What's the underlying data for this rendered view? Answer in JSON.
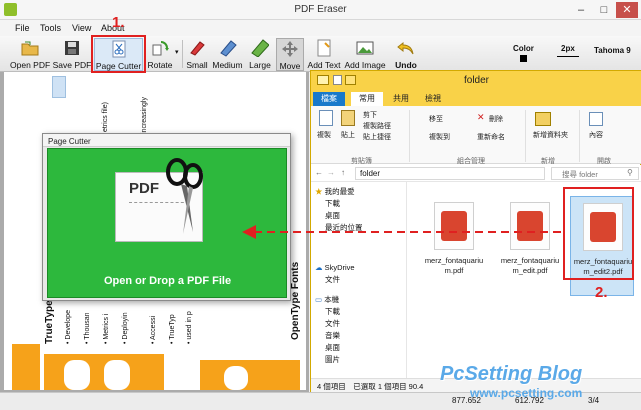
{
  "app": {
    "title": "PDF Eraser",
    "window_controls": [
      "–",
      "□",
      "✕"
    ],
    "menu": [
      "File",
      "Tools",
      "View",
      "About"
    ],
    "toolbar": [
      {
        "label": "Open PDF",
        "icon": "open-folder-icon"
      },
      {
        "label": "Save PDF",
        "icon": "floppy-disk-icon"
      },
      {
        "label": "Page Cutter",
        "icon": "page-cutter-icon"
      },
      {
        "label": "Rotate",
        "icon": "rotate-icon"
      },
      {
        "label": "Small",
        "icon": "eraser-small-icon"
      },
      {
        "label": "Medium",
        "icon": "eraser-medium-icon"
      },
      {
        "label": "Large",
        "icon": "eraser-large-icon"
      },
      {
        "label": "Move",
        "icon": "move-icon"
      },
      {
        "label": "Add Text",
        "icon": "add-text-icon"
      },
      {
        "label": "Add Image",
        "icon": "add-image-icon"
      },
      {
        "label": "Undo",
        "icon": "undo-icon"
      }
    ],
    "color_label": "Color",
    "size_value": "2px",
    "font_value": "Tahoma 9",
    "status": {
      "left": "877.652",
      "middle": "612.792",
      "page": "3/4"
    }
  },
  "document_text": {
    "col1": [
      "TrueType Fonts",
      "• Develope",
      "• Thousan",
      "• Metrics i",
      "• Deployin"
    ],
    "col2": [
      "• Accessi",
      "• TrueTyp",
      "• used in p"
    ],
    "right_vertical": [
      "OpenType Fonts"
    ],
    "top_vertical": [
      "etrics file)",
      "increasingly"
    ]
  },
  "page_cutter": {
    "title": "Page Cutter",
    "drop_label": "Open or Drop a PDF File",
    "pdf_label": "PDF"
  },
  "explorer": {
    "title": "folder",
    "tabs": [
      "檔案",
      "常用",
      "共用",
      "檢視"
    ],
    "ribbon": {
      "clipboard": [
        "複製",
        "貼上",
        "剪下",
        "複製路徑",
        "貼上捷徑"
      ],
      "clipboard_group": "剪貼簿",
      "organize": [
        "移至",
        "複製到",
        "刪除",
        "重新命名"
      ],
      "organize_group": "組合管理",
      "new": [
        "新增資料夾"
      ],
      "new_group": "新增",
      "open": [
        "內容"
      ],
      "open_group": "開啟"
    },
    "address": "folder",
    "search_placeholder": "搜尋 folder",
    "nav": [
      {
        "label": "我的最愛",
        "indent": 0
      },
      {
        "label": "下載",
        "indent": 1
      },
      {
        "label": "桌面",
        "indent": 1
      },
      {
        "label": "最近的位置",
        "indent": 1
      },
      {
        "label": "SkyDrive",
        "indent": 0
      },
      {
        "label": "文件",
        "indent": 1
      },
      {
        "label": "本機",
        "indent": 0
      },
      {
        "label": "下載",
        "indent": 1
      },
      {
        "label": "文件",
        "indent": 1
      },
      {
        "label": "音樂",
        "indent": 1
      },
      {
        "label": "桌面",
        "indent": 1
      },
      {
        "label": "圖片",
        "indent": 1
      }
    ],
    "files": [
      {
        "name": "merz_fontaquarium.pdf",
        "selected": false
      },
      {
        "name": "merz_fontaquarium_edit.pdf",
        "selected": false
      },
      {
        "name": "merz_fontaquarium_edit2.pdf",
        "selected": true
      }
    ],
    "status": "4 個項目　已選取 1 個項目 90.4"
  },
  "annotations": {
    "step1": "1.",
    "step2": "2.",
    "watermark": "PcSetting Blog",
    "watermark_url": "www.pcsetting.com",
    "accent": "#e02020"
  }
}
